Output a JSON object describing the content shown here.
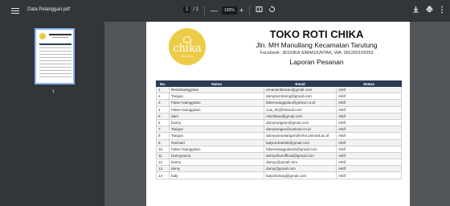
{
  "toolbar": {
    "title": "Data Pelanggan.pdf",
    "page_current": "1",
    "page_total": "/ 1",
    "zoom": "100%",
    "zoom_out": "—",
    "zoom_in": "+"
  },
  "sidebar": {
    "thumb_label": "1"
  },
  "document": {
    "logo_text": "chika",
    "logo_sub": "ROTI CHIKA",
    "shop_title": "TOKO ROTI CHIKA",
    "shop_address": "Jln. MH Manullang Kecamatan Tarutung",
    "shop_contact": "Facebook: JESSIKA SIMANJUNTAK, WA: 081260155053",
    "report_title": "Laporan Pesanan",
    "table": {
      "headers": [
        "No.",
        "Nama",
        "Email",
        "Status"
      ],
      "rows": [
        [
          "1",
          "RenaNainggolan",
          "renanainkbotan@gmail.com",
          "Aktif"
        ],
        [
          "2",
          "Tarigan",
          "damysembiring@gmail.com",
          "Aktif"
        ],
        [
          "3",
          "Faber Nainggolan",
          "fabernainggolan@yahoo.co.id",
          "Aktif"
        ],
        [
          "4",
          "Faber Nainggolan",
          "cow_ks@hotmail.com",
          "Aktif"
        ],
        [
          "5",
          "dam",
          "rotichikaa@gmail.com",
          "Aktif"
        ],
        [
          "6",
          "Damy",
          "damytarigann@gmail.com",
          "Aktif"
        ],
        [
          "7",
          "Tarigan",
          "damytarigan@outlook.co.id",
          "Aktif"
        ],
        [
          "8",
          "Tarigan",
          "damyyanuelarigan@mhs.unimed.ac.id",
          "Aktif"
        ],
        [
          "9",
          "Rachael",
          "ladyrachael36@gmail.com",
          "Aktif"
        ],
        [
          "10",
          "Faber Nainggolan",
          "fabernainggolan22@gmail.com",
          "Aktif"
        ],
        [
          "11",
          "Damyyanus",
          "damydriveofficial@gmail.com",
          "Aktif"
        ],
        [
          "12",
          "Damy",
          "damyy@gmail.com",
          "Aktif"
        ],
        [
          "13",
          "damy",
          "damy@gmail.com",
          "Aktif"
        ],
        [
          "14",
          "lady",
          "ladyshotang@gmail.com",
          "Aktif"
        ]
      ]
    }
  },
  "colors": {
    "toolbar_bg": "#323639",
    "viewer_bg": "#525659",
    "logo_yellow": "#eccb47",
    "table_header": "#2b3a55",
    "thumb_border": "#8ab4f8"
  }
}
